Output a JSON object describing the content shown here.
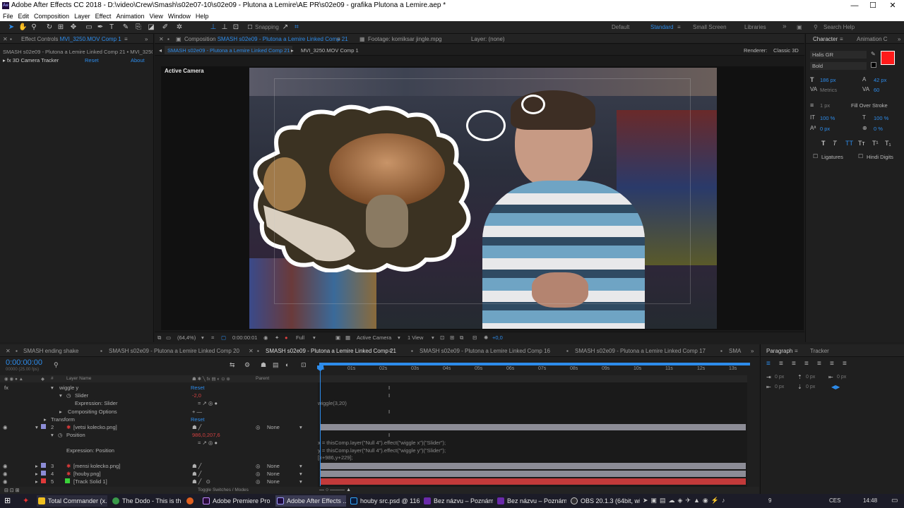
{
  "window": {
    "title": "Adobe After Effects CC 2018 - D:\\video\\Crew\\Smash\\s02e07-10\\s02e09 - Plutona a Lemire\\AE PR\\s02e09 - grafika Plutona a Lemire.aep *",
    "min": "—",
    "max": "☐",
    "close": "✕"
  },
  "menu": [
    "File",
    "Edit",
    "Composition",
    "Layer",
    "Effect",
    "Animation",
    "View",
    "Window",
    "Help"
  ],
  "toolbar": {
    "snapping": "Snapping",
    "workspaces": [
      "Default",
      "Standard",
      "Small Screen",
      "Libraries"
    ],
    "search": "Search Help"
  },
  "effect_controls": {
    "tab": "Effect Controls",
    "tab_blue": "MVI_3250.MOV Comp 1",
    "breadcrumb": "SMASH s02e09 - Plutona a Lemire Linked Comp 21 • MVI_3250.M",
    "effect": "3D Camera Tracker",
    "reset": "Reset",
    "about": "About"
  },
  "composition": {
    "tab": "Composition",
    "tab_blue": "SMASH s02e09 - Plutona a Lemire Linked Comp 21",
    "footage": "Footage: komiksar jingle.mpg",
    "layer": "Layer: (none)",
    "subtab1": "SMASH s02e09 - Plutona a Lemire Linked Comp 21",
    "subtab2": "MVI_3250.MOV Comp 1",
    "renderer_label": "Renderer:",
    "renderer": "Classic 3D",
    "active_camera": "Active Camera"
  },
  "viewer_bar": {
    "zoom": "(64,4%)",
    "time": "0:00:00:01",
    "quality": "Full",
    "camera": "Active Camera",
    "views": "1 View",
    "exposure": "+0,0"
  },
  "character": {
    "tab": "Character",
    "tab2": "Animation C",
    "font": "Halis GR",
    "style": "Bold",
    "size": "186 px",
    "leading": "42 px",
    "kern": "Metrics",
    "track": "60",
    "stroke": "1 px",
    "stroke_mode": "Fill Over Stroke",
    "vscale": "100 %",
    "hscale": "100 %",
    "baseline": "0 px",
    "tsume": "0 %",
    "ligatures": "Ligatures",
    "hindi": "Hindi Digits",
    "fill_color": "#ff1a1a",
    "styles": [
      "T",
      "T",
      "TT",
      "Tт",
      "T¹",
      "T₁"
    ]
  },
  "timeline": {
    "tabs": [
      "SMASH ending shake",
      "SMASH s02e09 - Plutona a Lemire Linked Comp 20",
      "SMASH s02e09 - Plutona a Lemire Linked Comp 21",
      "SMASH s02e09 - Plutona a Lemire Linked Comp 16",
      "SMASH s02e09 - Plutona a Lemire Linked Comp 17",
      "SMA"
    ],
    "timecode": "0:00:00:00",
    "fps": "00000 (25.00 fps)",
    "col_layer": "Layer Name",
    "col_parent": "Parent",
    "hash": "#",
    "ruler": [
      "0s",
      "01s",
      "02s",
      "03s",
      "04s",
      "05s",
      "06s",
      "07s",
      "08s",
      "09s",
      "10s",
      "11s",
      "12s",
      "13s"
    ],
    "rows": [
      {
        "name": "wiggle y",
        "reset": "Reset"
      },
      {
        "name": "Slider",
        "value": "-2,0"
      },
      {
        "name": "Expression: Slider",
        "expr": "wiggle(3,20)"
      },
      {
        "name": "Compositing Options",
        "ops": "+ —"
      },
      {
        "name": "Transform",
        "reset": "Reset"
      },
      {
        "num": "2",
        "name": "[vetsi kolecko.png]",
        "parent": "None"
      },
      {
        "name": "Position",
        "value": "986,0,207,6"
      },
      {
        "name": "Expression: Position",
        "expr1": "x = thisComp.layer(\"Null 4\").effect(\"wiggle x\")(\"Slider\");",
        "expr2": "y = thisComp.layer(\"Null 4\").effect(\"wiggle y\")(\"Slider\");",
        "expr3": "[x+986,y+229];"
      },
      {
        "num": "3",
        "name": "[mensi kolecko.png]",
        "parent": "None"
      },
      {
        "num": "4",
        "name": "[houby.png]",
        "parent": "None"
      },
      {
        "num": "5",
        "name": "[Track Solid 1]",
        "parent": "None"
      }
    ],
    "toggle": "Toggle Switches / Modes"
  },
  "paragraph": {
    "tab": "Paragraph",
    "tab2": "Tracker",
    "vals": [
      "0 px",
      "0 px",
      "0 px",
      "0 px",
      "0 px"
    ]
  },
  "taskbar": {
    "items": [
      "Total Commander (x...",
      "The Dodo - This is th...",
      "",
      "Adobe Premiere Pro ...",
      "Adobe After Effects ...",
      "houby src.psd @ 116...",
      "Bez názvu – Poznám...",
      "Bez názvu – Poznám...",
      "OBS 20.1.3 (64bit, wi..."
    ],
    "lang": "CES",
    "time": "14:48",
    "count": "9"
  },
  "colors": {
    "accent": "#2d8ceb",
    "layer_bar": "#8c8c96",
    "track_solid": "#c23a3a",
    "label_red": "#e03a3a",
    "label_green": "#3ad23a"
  }
}
